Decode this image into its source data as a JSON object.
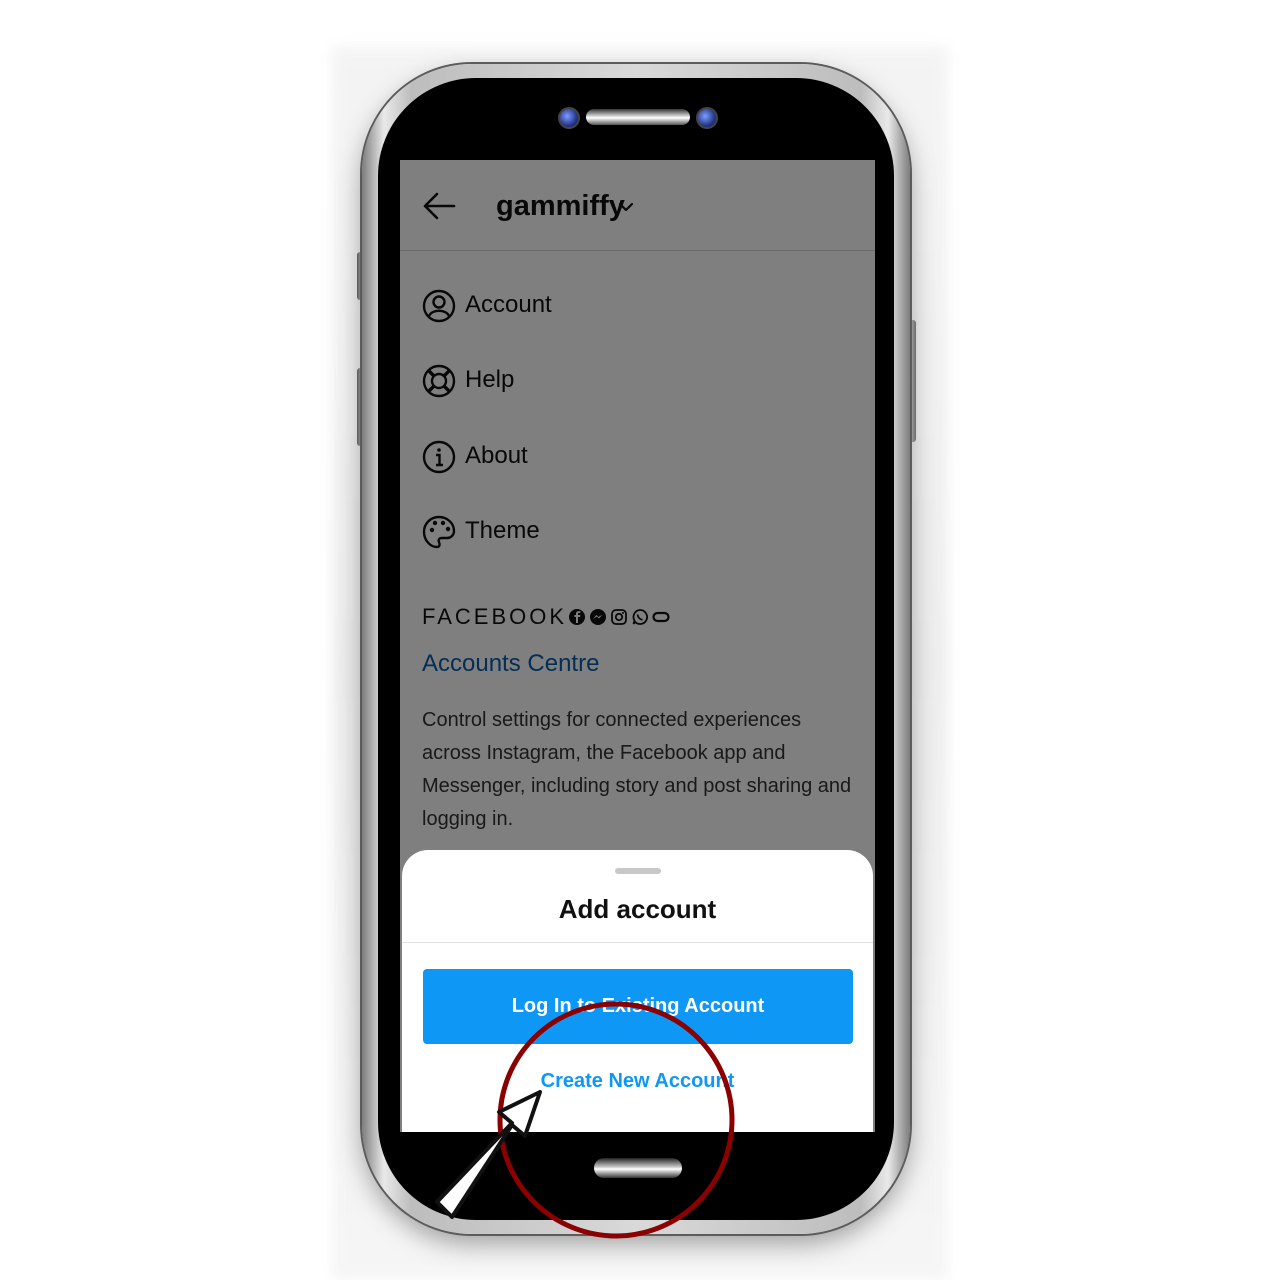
{
  "header": {
    "username": "gammiffy",
    "back_icon": "back-arrow-icon",
    "switch_icon": "chevron-down-icon"
  },
  "menu": {
    "items": [
      {
        "label": "Account",
        "icon": "account-icon"
      },
      {
        "label": "Help",
        "icon": "help-lifebuoy-icon"
      },
      {
        "label": "About",
        "icon": "info-icon"
      },
      {
        "label": "Theme",
        "icon": "palette-icon"
      }
    ]
  },
  "facebook": {
    "brand": "FACEBOOK",
    "icons": [
      "facebook-icon",
      "messenger-icon",
      "instagram-icon",
      "whatsapp-icon",
      "portal-icon"
    ],
    "accounts_centre": "Accounts Centre",
    "description": "Control settings for connected experiences across Instagram, the Facebook app and Messenger, including story and post sharing and logging in."
  },
  "sheet": {
    "title": "Add account",
    "login_button": "Log In to Existing Account",
    "create_link": "Create New Account"
  },
  "colors": {
    "accent": "#0f97f6",
    "link": "#0a5cad",
    "annotation": "#8b0000"
  }
}
